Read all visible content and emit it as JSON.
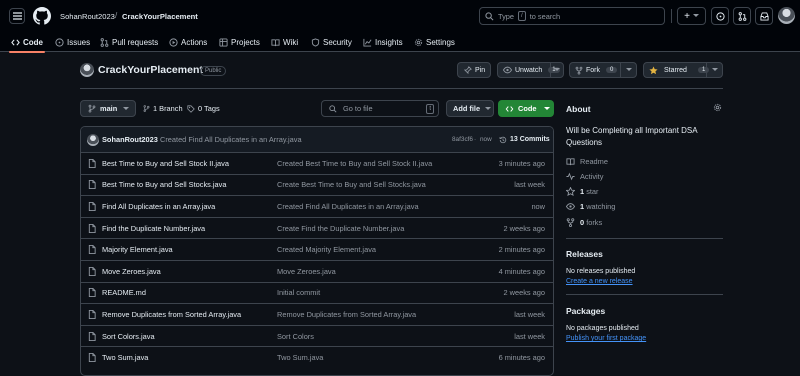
{
  "header": {
    "owner": "SohanRout2023",
    "separator": "/",
    "repo": "CrackYourPlacement",
    "search_prefix": "Type",
    "search_key": "/",
    "search_suffix": "to search",
    "plus": "+"
  },
  "tabs": [
    {
      "label": "Code",
      "icon": "code-icon"
    },
    {
      "label": "Issues",
      "icon": "issue-icon"
    },
    {
      "label": "Pull requests",
      "icon": "pull-request-icon"
    },
    {
      "label": "Actions",
      "icon": "play-icon"
    },
    {
      "label": "Projects",
      "icon": "table-icon"
    },
    {
      "label": "Wiki",
      "icon": "book-icon"
    },
    {
      "label": "Security",
      "icon": "shield-icon"
    },
    {
      "label": "Insights",
      "icon": "graph-icon"
    },
    {
      "label": "Settings",
      "icon": "gear-icon"
    }
  ],
  "repo": {
    "name": "CrackYourPlacement",
    "visibility": "Public",
    "pin": "Pin",
    "unwatch": "Unwatch",
    "unwatch_count": "1",
    "fork": "Fork",
    "fork_count": "0",
    "starred": "Starred",
    "star_count": "1"
  },
  "toolbar": {
    "branch": "main",
    "branches": "1 Branch",
    "tags": "0 Tags",
    "goto_placeholder": "Go to file",
    "goto_key": "t",
    "add_file": "Add file",
    "code": "Code"
  },
  "commit": {
    "author": "SohanRout2023",
    "message": "Created Find All Duplicates in an Array.java",
    "hash": "8af3cf6",
    "sep": "·",
    "age": "now",
    "count": "13 Commits"
  },
  "files": [
    {
      "name": "Best Time to Buy and Sell Stock II.java",
      "message": "Created Best Time to Buy and Sell Stock II.java",
      "time": "3 minutes ago"
    },
    {
      "name": "Best Time to Buy and Sell Stocks.java",
      "message": "Create Best Time to Buy and Sell Stocks.java",
      "time": "last week"
    },
    {
      "name": "Find All Duplicates in an Array.java",
      "message": "Created Find All Duplicates in an Array.java",
      "time": "now"
    },
    {
      "name": "Find the Duplicate Number.java",
      "message": "Create Find the Duplicate Number.java",
      "time": "2 weeks ago"
    },
    {
      "name": "Majority Element.java",
      "message": "Created Majority Element.java",
      "time": "2 minutes ago"
    },
    {
      "name": "Move Zeroes.java",
      "message": "Move Zeroes.java",
      "time": "4 minutes ago"
    },
    {
      "name": "README.md",
      "message": "Initial commit",
      "time": "2 weeks ago"
    },
    {
      "name": "Remove Duplicates from Sorted Array.java",
      "message": "Remove Duplicates from Sorted Array.java",
      "time": "last week"
    },
    {
      "name": "Sort Colors.java",
      "message": "Sort Colors",
      "time": "last week"
    },
    {
      "name": "Two Sum.java",
      "message": "Two Sum.java",
      "time": "6 minutes ago"
    }
  ],
  "about": {
    "title": "About",
    "description": "Will be Completing all Important DSA Questions",
    "readme": "Readme",
    "activity": "Activity",
    "stars_n": "1",
    "stars": "star",
    "watching_n": "1",
    "watching": "watching",
    "forks_n": "0",
    "forks": "forks"
  },
  "releases": {
    "title": "Releases",
    "empty": "No releases published",
    "link": "Create a new release"
  },
  "packages": {
    "title": "Packages",
    "empty": "No packages published",
    "link": "Publish your first package"
  },
  "colors": {
    "bg": "#0d1117",
    "header": "#010409",
    "border": "#3d444d",
    "accent": "#238636",
    "link": "#4493f8",
    "underline": "#f78166",
    "star": "#e3b341"
  }
}
